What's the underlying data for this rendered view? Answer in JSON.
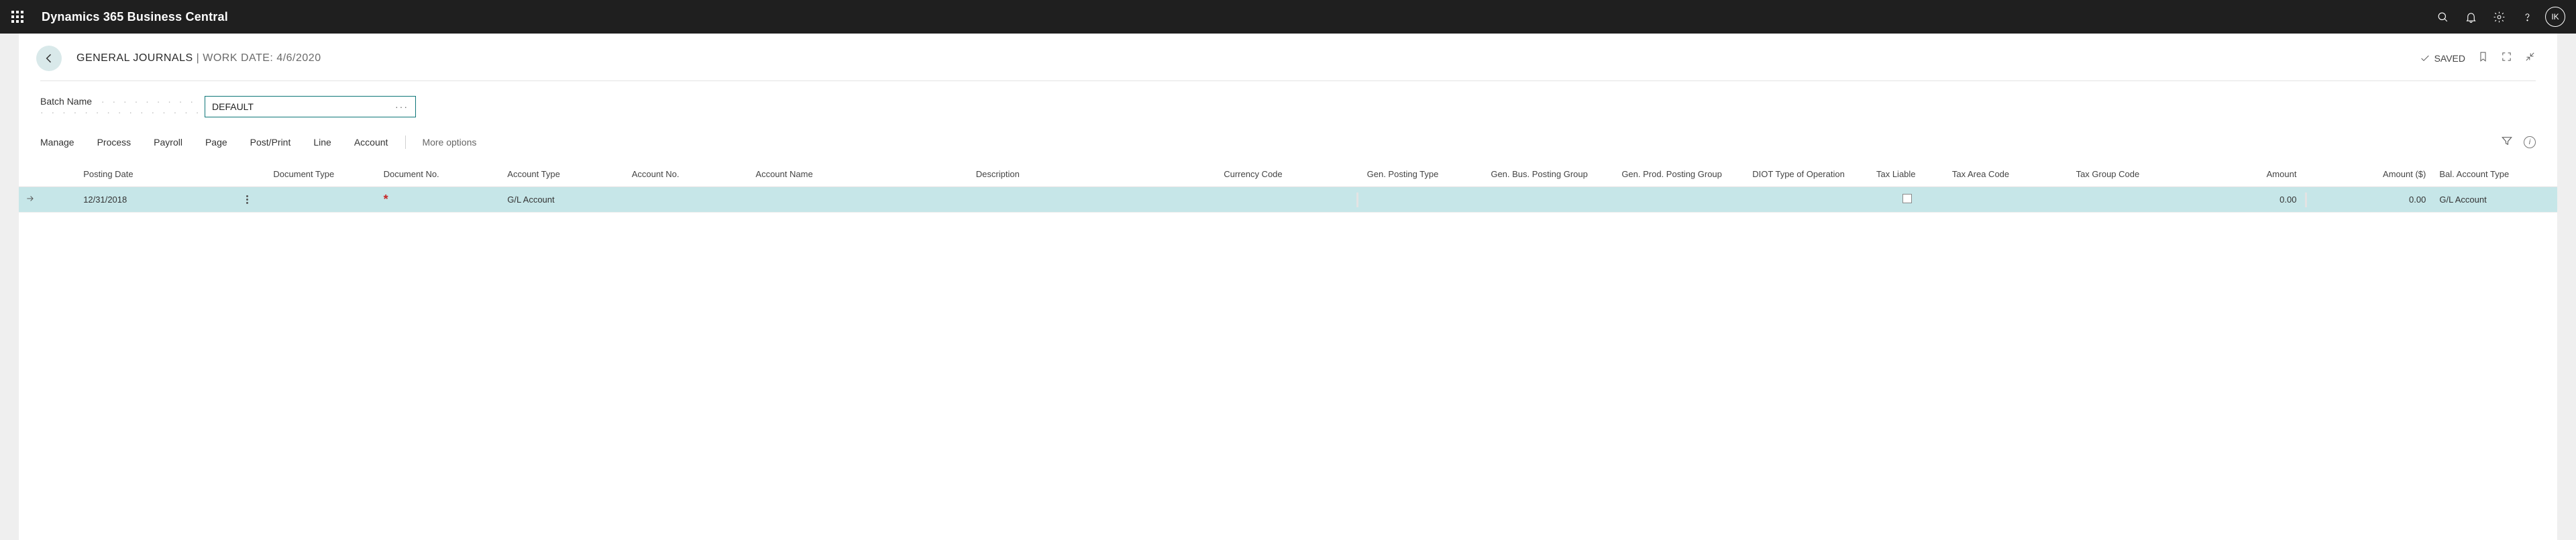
{
  "topbar": {
    "brand": "Dynamics 365 Business Central",
    "avatar": "IK"
  },
  "header": {
    "title_main": "GENERAL JOURNALS",
    "title_sep": " | ",
    "title_sub": "WORK DATE: 4/6/2020",
    "saved_label": "SAVED"
  },
  "batch": {
    "label": "Batch Name",
    "value": "DEFAULT"
  },
  "menu": {
    "manage": "Manage",
    "process": "Process",
    "payroll": "Payroll",
    "page": "Page",
    "postprint": "Post/Print",
    "line": "Line",
    "account": "Account",
    "more": "More options"
  },
  "grid": {
    "headers": {
      "posting_date": "Posting Date",
      "document_type": "Document Type",
      "document_no": "Document No.",
      "account_type": "Account Type",
      "account_no": "Account No.",
      "account_name": "Account Name",
      "description": "Description",
      "currency_code": "Currency Code",
      "gen_posting_type": "Gen. Posting Type",
      "gen_bus_group": "Gen. Bus. Posting Group",
      "gen_prod_group": "Gen. Prod. Posting Group",
      "diot_type": "DIOT Type of Operation",
      "tax_liable": "Tax Liable",
      "tax_area_code": "Tax Area Code",
      "tax_group_code": "Tax Group Code",
      "amount": "Amount",
      "amount_usd": "Amount ($)",
      "bal_account_type": "Bal. Account Type"
    },
    "rows": [
      {
        "posting_date": "12/31/2018",
        "document_type": "",
        "document_no": "*",
        "account_type": "G/L Account",
        "account_no": "",
        "account_name": "",
        "description": "",
        "currency_code": "",
        "gen_posting_type": "",
        "gen_bus_group": "",
        "gen_prod_group": "",
        "diot_type": "",
        "tax_liable": false,
        "tax_area_code": "",
        "tax_group_code": "",
        "amount": "0.00",
        "amount_usd": "0.00",
        "bal_account_type": "G/L Account"
      }
    ]
  }
}
